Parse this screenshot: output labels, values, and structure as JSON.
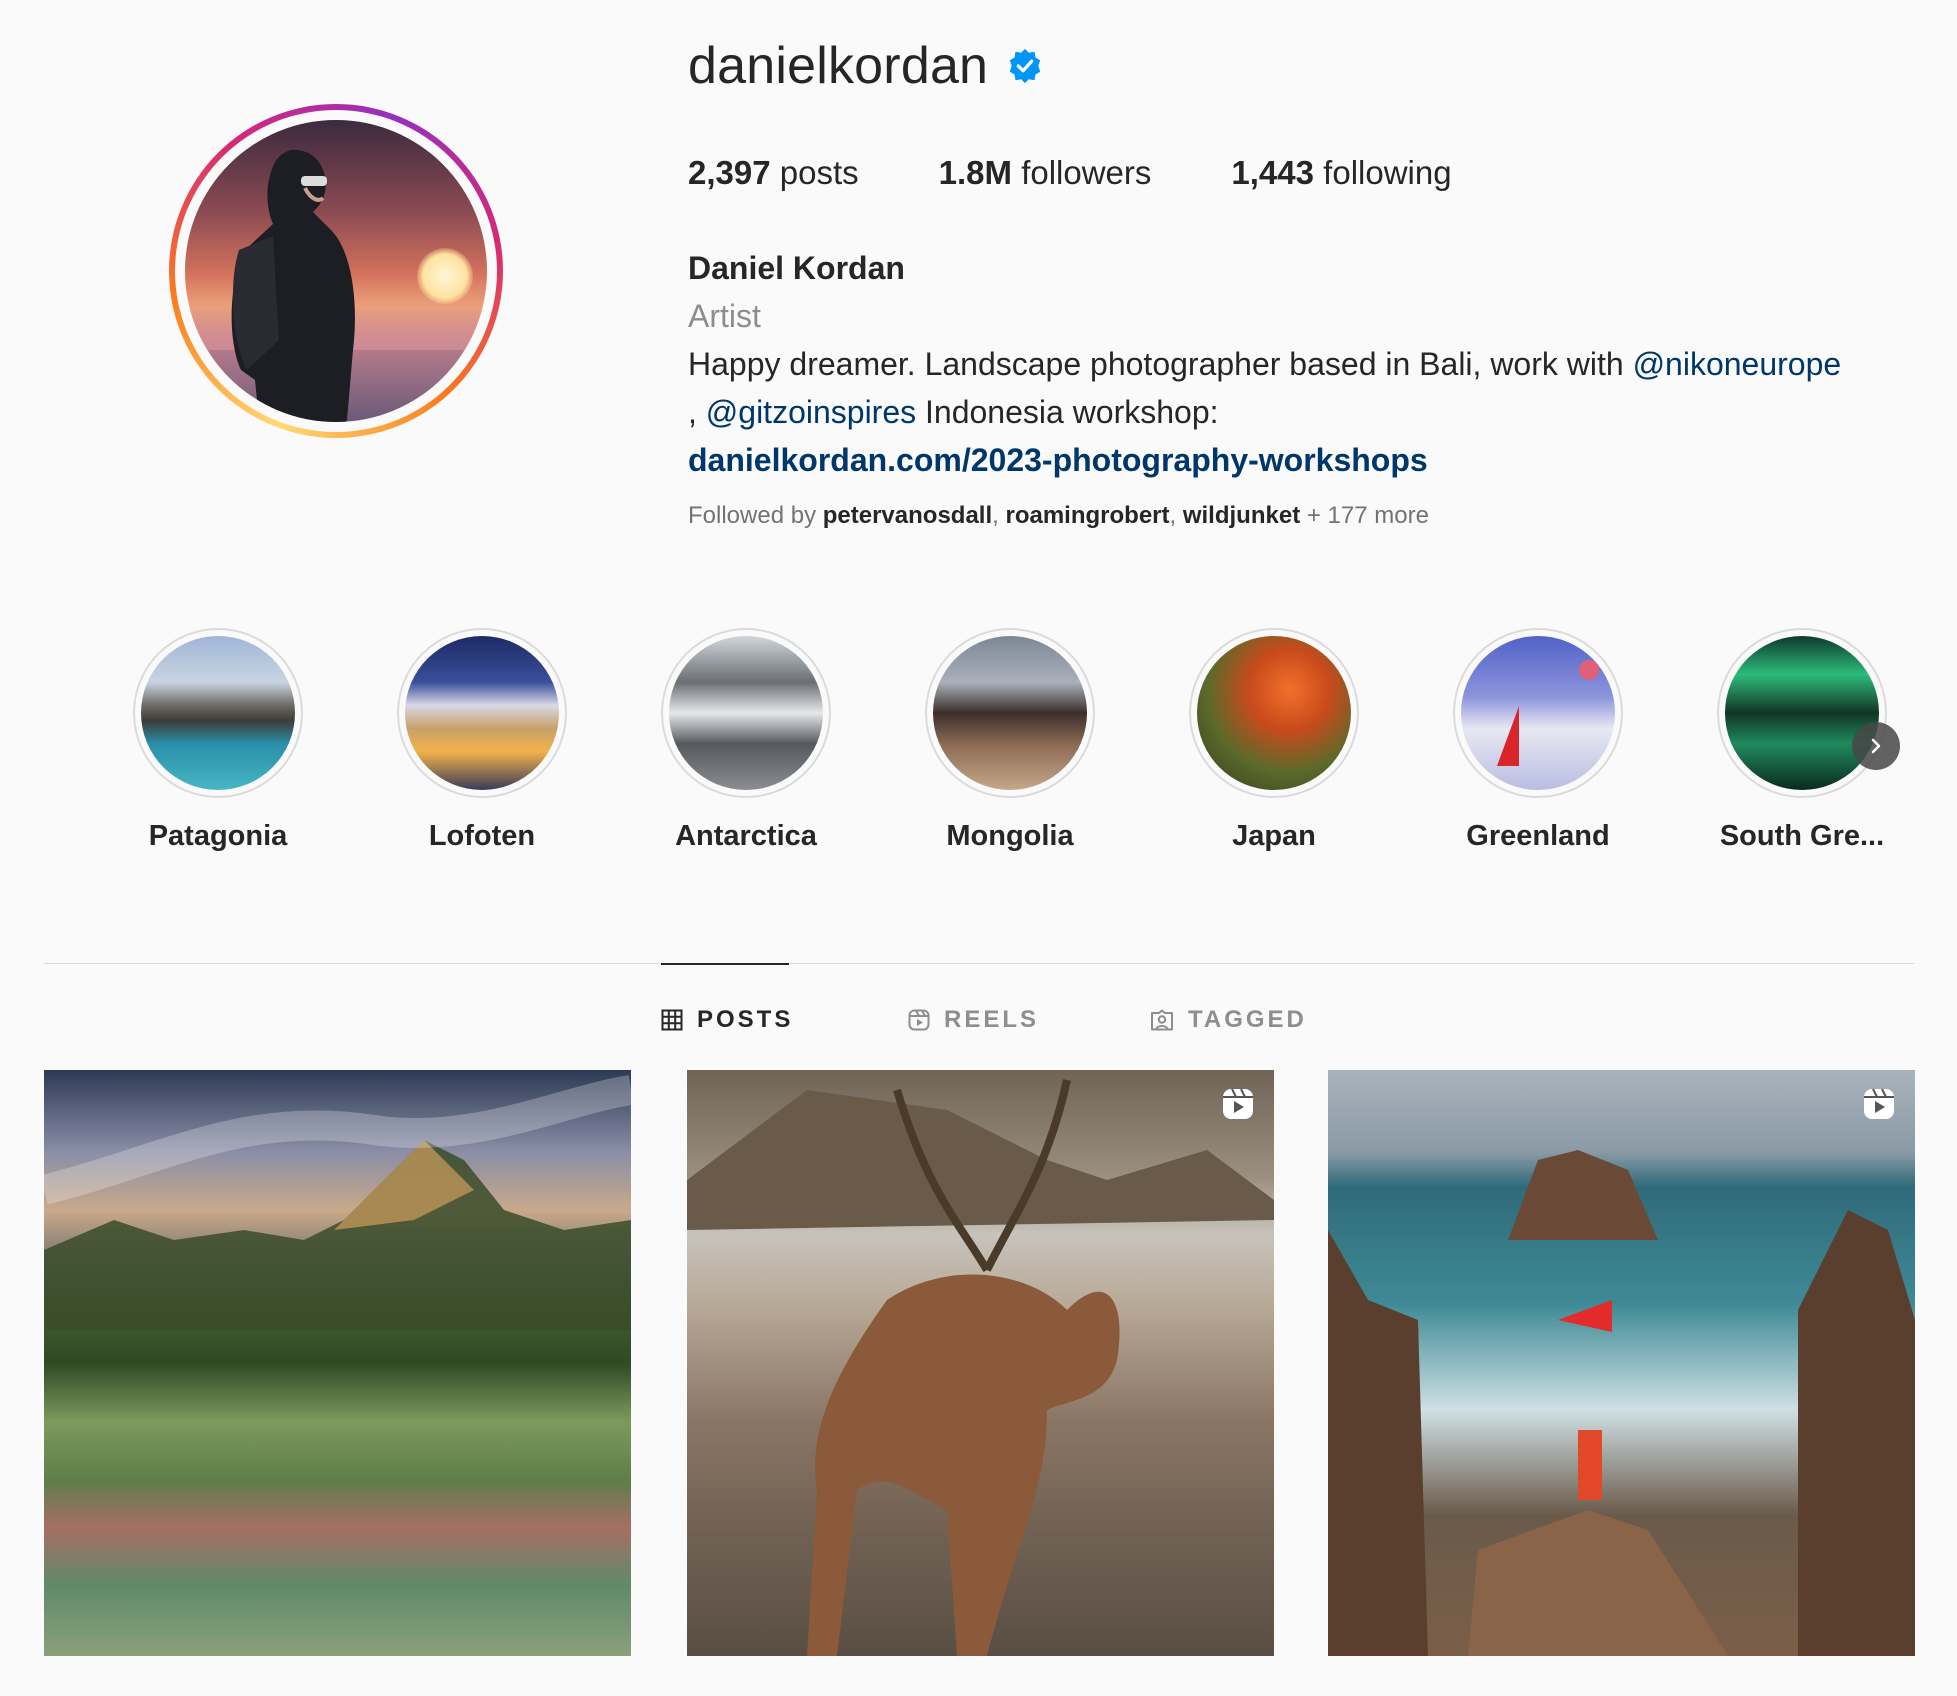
{
  "profile": {
    "username": "danielkordan",
    "verified": true,
    "stats": {
      "posts_count": "2,397",
      "posts_label": "posts",
      "followers_count": "1.8M",
      "followers_label": "followers",
      "following_count": "1,443",
      "following_label": "following"
    },
    "full_name": "Daniel Kordan",
    "category": "Artist",
    "bio_text_1": "Happy dreamer. Landscape photographer based in Bali, work with ",
    "bio_mention_1": "@nikoneurope",
    "bio_text_2": ", ",
    "bio_mention_2": "@gitzoinspires",
    "bio_text_3": " Indonesia workshop:",
    "website": "danielkordan.com/2023-photography-workshops",
    "followed_by_prefix": "Followed by ",
    "followed_by_users": [
      "petervanosdall",
      "roamingrobert",
      "wildjunket"
    ],
    "followed_by_sep": ", ",
    "followed_by_more": " + 177 more"
  },
  "highlights": [
    {
      "label": "Patagonia"
    },
    {
      "label": "Lofoten"
    },
    {
      "label": "Antarctica"
    },
    {
      "label": "Mongolia"
    },
    {
      "label": "Japan"
    },
    {
      "label": "Greenland"
    },
    {
      "label": "South Gre..."
    }
  ],
  "tabs": {
    "posts": "POSTS",
    "reels": "REELS",
    "tagged": "TAGGED",
    "active": "posts"
  },
  "posts": [
    {
      "type": "photo"
    },
    {
      "type": "reel"
    },
    {
      "type": "reel"
    }
  ],
  "colors": {
    "background": "#fafafa",
    "text": "#262626",
    "secondary_text": "#8e8e8e",
    "link": "#00376b",
    "verified_badge": "#0095f6",
    "divider": "#dbdbdb"
  },
  "icons": {
    "verified": "verified-badge-icon",
    "next": "chevron-right-icon",
    "posts_tab": "grid-icon",
    "reels_tab": "reels-icon",
    "tagged_tab": "tagged-user-icon",
    "reel_overlay": "reel-icon"
  }
}
